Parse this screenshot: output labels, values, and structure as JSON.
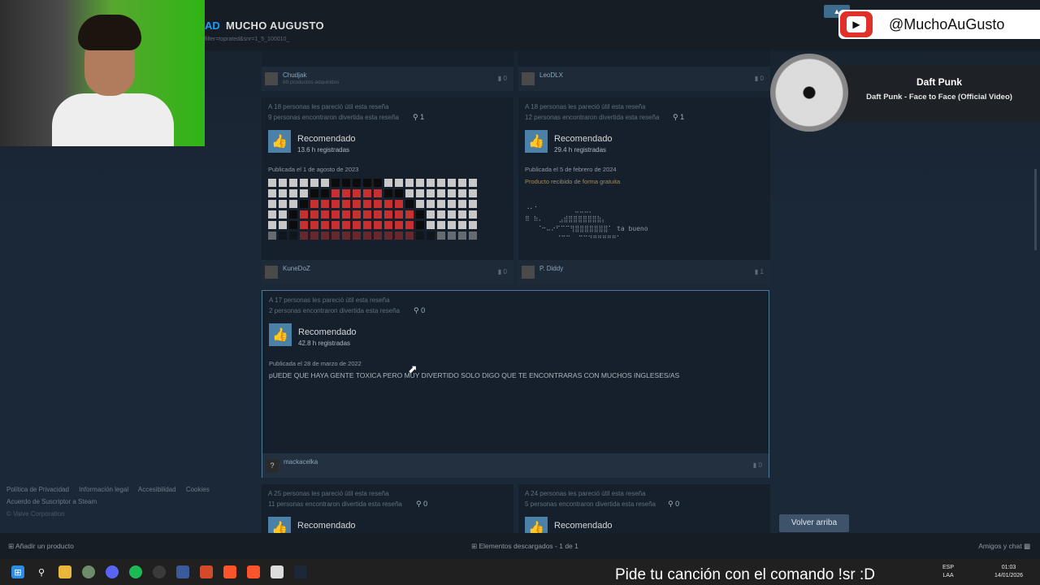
{
  "header": {
    "tab_active": "AD",
    "tab_user": "MUCHO AUGUSTO",
    "url": "filter=toprated&snr=1_5_100010_"
  },
  "reviews": {
    "top_left": {
      "author": "Chudjak",
      "sub": "80 productos adquiridos",
      "comments": "0"
    },
    "top_right": {
      "author": "LeoDLX",
      "comments": "0"
    },
    "r1": {
      "helpful": "A 18 personas les pareció útil esta reseña",
      "funny": "9 personas encontraron divertida esta reseña",
      "award": "1",
      "recommended": "Recomendado",
      "hours": "13.6 h registradas",
      "posted": "Publicada el 1 de agosto de 2023",
      "author": "KuneDoZ",
      "comments": "0"
    },
    "r2": {
      "helpful": "A 18 personas les pareció útil esta reseña",
      "funny": "12 personas encontraron divertida esta reseña",
      "award": "1",
      "recommended": "Recomendado",
      "hours": "29.4 h registradas",
      "posted": "Publicada el 5 de febrero de 2024",
      "gift": "Producto recibido de forma gratuita",
      "ascii_suffix": "ta bueno",
      "author": "P. Diddy",
      "comments": "1"
    },
    "r3": {
      "helpful": "A 17 personas les pareció útil esta reseña",
      "funny": "2 personas encontraron divertida esta reseña",
      "award": "0",
      "recommended": "Recomendado",
      "hours": "42.8 h registradas",
      "posted": "Publicada el 28 de marzo de 2022",
      "text": "pUEDE QUE HAYA GENTE TOXICA PERO MUY DIVERTIDO SOLO DIGO QUE TE ENCONTRARAS CON MUCHOS INGLESES/AS",
      "author": "mackacelka",
      "comments": "0"
    },
    "r4": {
      "helpful": "A 25 personas les pareció útil esta reseña",
      "funny": "11 personas encontraron divertida esta reseña",
      "award": "0",
      "recommended": "Recomendado"
    },
    "r5": {
      "helpful": "A 24 personas les pareció útil esta reseña",
      "funny": "5 personas encontraron divertida esta reseña",
      "award": "0",
      "recommended": "Recomendado"
    }
  },
  "volver": "Volver arriba",
  "legal": {
    "privacy": "Política de Privacidad",
    "legal_info": "Información legal",
    "accessibility": "Accesibilidad",
    "cookies": "Cookies",
    "subscriber": "Acuerdo de Suscriptor a Steam",
    "corp": "© Valve Corporation"
  },
  "bottombar": {
    "add": "Añadir un producto",
    "downloads": "Elementos descargados - 1 de 1",
    "friends": "Amigos y chat"
  },
  "overlay": {
    "yt_handle": "@MuchoAuGusto",
    "np_artist": "Daft Punk",
    "np_title": "Daft Punk - Face to Face (Official Video)",
    "chat_command": "Pide tu canción con el comando !sr :D"
  },
  "taskbar": {
    "lang": "ESP",
    "lang2": "LAA",
    "time": "01:03",
    "date": "14/01/2026"
  },
  "colors": {
    "accent": "#1a9fff",
    "pixel_red": "#c8302f",
    "pixel_gray": "#c8c8c8"
  }
}
